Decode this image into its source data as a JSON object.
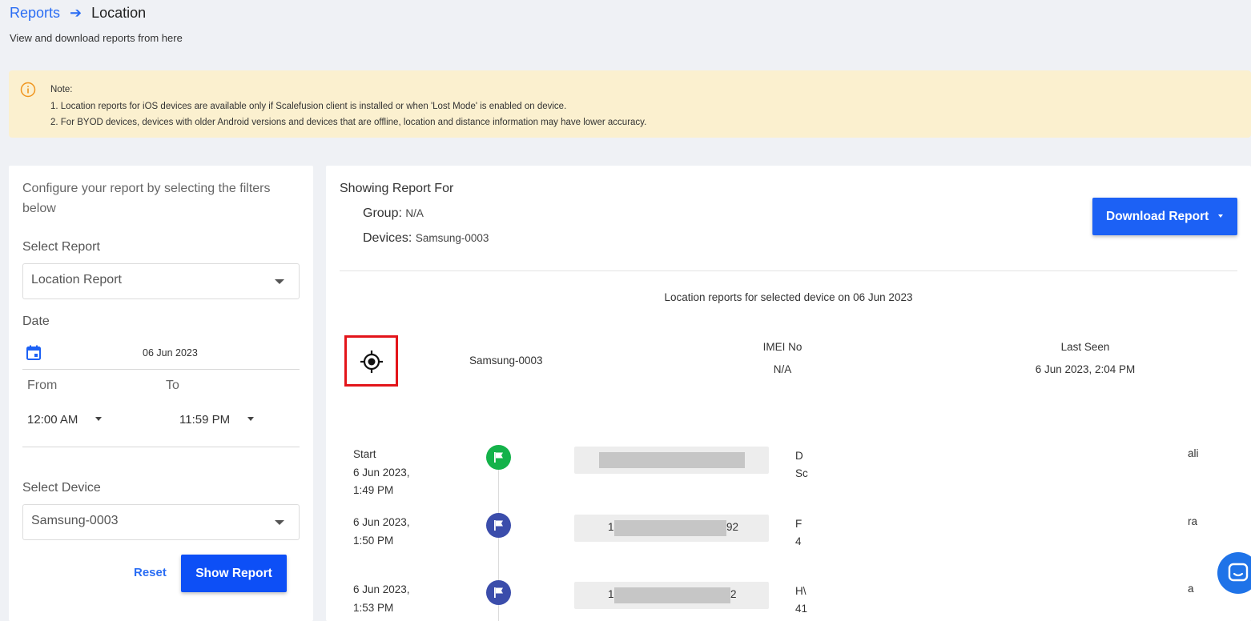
{
  "breadcrumb": {
    "parent": "Reports",
    "current": "Location"
  },
  "subtitle": "View and download reports from here",
  "note": {
    "title": "Note:",
    "line1": "1. Location reports for iOS devices are available only if Scalefusion client is installed or when 'Lost Mode' is enabled on device.",
    "line2": "2. For BYOD devices, devices with older Android versions and devices that are offline, location and distance information may have lower accuracy.",
    "icon": "info-icon"
  },
  "filters": {
    "title": "Configure your report by selecting the filters below",
    "select_report_label": "Select Report",
    "select_report_value": "Location Report",
    "date_label": "Date",
    "date_value": "06 Jun 2023",
    "from_label": "From",
    "to_label": "To",
    "from_value": "12:00 AM",
    "to_value": "11:59 PM",
    "select_device_label": "Select Device",
    "select_device_value": "Samsung-0003",
    "reset_label": "Reset",
    "show_label": "Show Report"
  },
  "report": {
    "showing_title": "Showing Report For",
    "group_label": "Group:",
    "group_value": "N/A",
    "devices_label": "Devices:",
    "devices_value": "Samsung-0003",
    "download_label": "Download Report",
    "caption": "Location reports for selected device on 06 Jun 2023",
    "device_name": "Samsung-0003",
    "imei_label": "IMEI No",
    "imei_value": "N/A",
    "last_seen_label": "Last Seen",
    "last_seen_value": "6 Jun 2023, 2:04 PM"
  },
  "timeline": [
    {
      "line1": "Start",
      "line2": "6 Jun 2023,",
      "line3": "1:49 PM",
      "coord": "",
      "addr1": "D",
      "addr2": "Sc",
      "addr_tail": "ali"
    },
    {
      "line1": "6 Jun 2023,",
      "line2": "1:50 PM",
      "coord": "1",
      "coord_tail": "92",
      "addr1": "F",
      "addr2": "4",
      "addr_tail": "ra"
    },
    {
      "line1": "6 Jun 2023,",
      "line2": "1:53 PM",
      "coord": "1",
      "coord_tail": "2",
      "addr1": "H\\",
      "addr2": "41",
      "addr_tail": "a"
    }
  ],
  "colors": {
    "accent": "#2a6df4",
    "primary_button": "#0d4ff6",
    "note_bg": "#fbf0cf",
    "start_flag": "#14b24a",
    "waypoint_flag": "#3b4dab",
    "highlight_box": "#e3141a"
  }
}
